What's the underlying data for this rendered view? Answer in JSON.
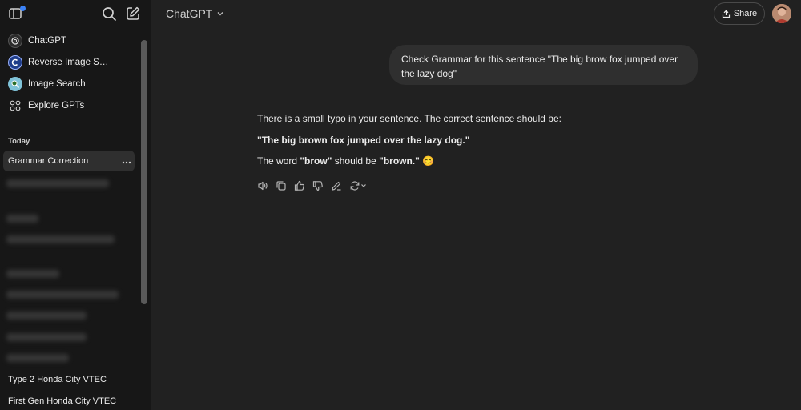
{
  "sidebar": {
    "nav": [
      {
        "label": "ChatGPT",
        "icon": "openai-logo-icon"
      },
      {
        "label": "Reverse Image Search",
        "icon": "reverse-image-search-gpt-icon"
      },
      {
        "label": "Image Search",
        "icon": "image-search-gpt-icon"
      },
      {
        "label": "Explore GPTs",
        "icon": "grid-icon"
      }
    ],
    "section_today": "Today",
    "active_chat": "Grammar Correction",
    "history_bottom": [
      {
        "label": "Type 2 Honda City VTEC"
      },
      {
        "label": "First Gen Honda City VTEC"
      }
    ]
  },
  "header": {
    "model": "ChatGPT",
    "share_label": "Share"
  },
  "conversation": {
    "user_message": "Check Grammar for this sentence \"The big brow fox jumped over the lazy dog\"",
    "assistant": {
      "line1": "There is a small typo in your sentence. The correct sentence should be:",
      "line2": "\"The big brown fox jumped over the lazy dog.\"",
      "line3_prefix": "The word ",
      "line3_wrong": "\"brow\"",
      "line3_middle": " should be ",
      "line3_right": "\"brown.\"",
      "line3_emoji": "😊"
    }
  },
  "colors": {
    "background": "#212121",
    "sidebar": "#171717",
    "bubble": "#2f2f2f",
    "accent_dot": "#3b82f6"
  }
}
